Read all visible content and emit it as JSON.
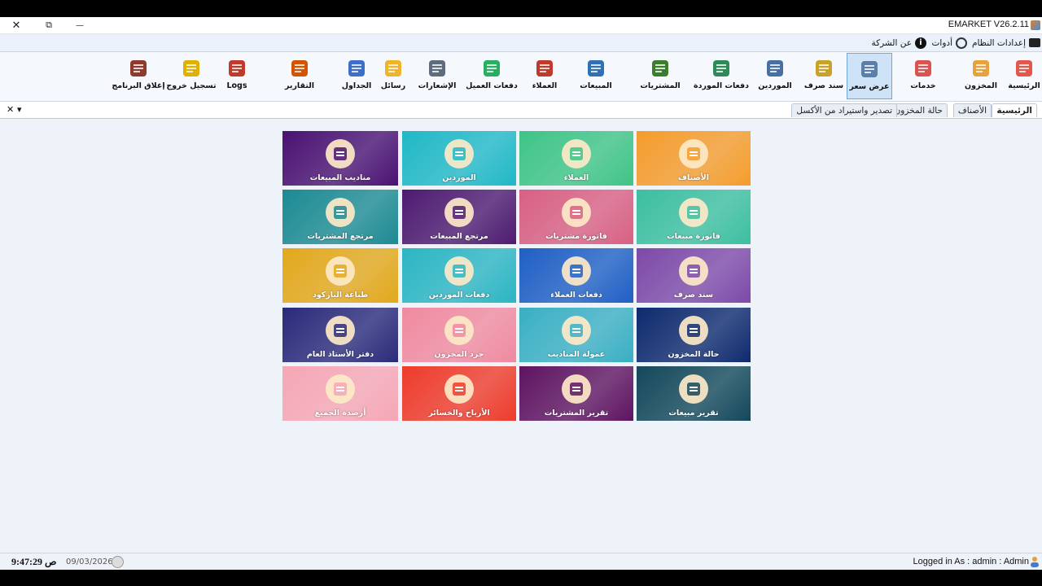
{
  "window": {
    "title": "EMARKET V26.2.11",
    "close_glyph": "✕",
    "restore_glyph": "⧉",
    "minimize_glyph": "—"
  },
  "menubar": {
    "settings": "إعدادات النظام",
    "tools": "أدوات",
    "about": "عن الشركة"
  },
  "ribbon": [
    {
      "label": "الرئيسية",
      "icon": "house-icon",
      "color": "#e2574c"
    },
    {
      "label": "المخزون",
      "icon": "warehouse-icon",
      "color": "#e8a23b"
    },
    {
      "label": "خدمات",
      "icon": "gift-icon",
      "color": "#d9534f"
    },
    {
      "label": "عرض سعر",
      "icon": "price-quote-icon",
      "color": "#5b7fa6"
    },
    {
      "label": "سند صرف",
      "icon": "cash-voucher-icon",
      "color": "#c9a227"
    },
    {
      "label": "الموردين",
      "icon": "supplier-icon",
      "color": "#4a6fa5"
    },
    {
      "label": "دفعات الموردة",
      "icon": "supplier-payment-icon",
      "color": "#2e8b57"
    },
    {
      "label": "المشتريات",
      "icon": "purchases-icon",
      "color": "#3a7d2c"
    },
    {
      "label": "المبيعات",
      "icon": "sales-cart-icon",
      "color": "#2f6fb3"
    },
    {
      "label": "العملاء",
      "icon": "customers-icon",
      "color": "#c0392b"
    },
    {
      "label": "دفعات العميل",
      "icon": "customer-payment-icon",
      "color": "#27ae60"
    },
    {
      "label": "الإشعارات",
      "icon": "notifications-icon",
      "color": "#5d6d7e"
    },
    {
      "label": "رسائل",
      "icon": "sms-envelope-icon",
      "color": "#f0b429"
    },
    {
      "label": "الجداول",
      "icon": "tables-grid-icon",
      "color": "#3d6ec9"
    },
    {
      "label": "التقارير",
      "icon": "reports-chart-icon",
      "color": "#d35400"
    },
    {
      "label": "Logs",
      "icon": "logs-file-icon",
      "color": "#c0392b"
    },
    {
      "label": "تسجيل خروج",
      "icon": "lock-icon",
      "color": "#e0b000"
    },
    {
      "label": "إغلاق البرنامج",
      "icon": "exit-door-icon",
      "color": "#8e3b2e"
    }
  ],
  "tabs": [
    {
      "label": "الرئيسية",
      "active": true
    },
    {
      "label": "الأصناف",
      "active": false
    },
    {
      "label": "حالة المخزون",
      "active": false
    },
    {
      "label": "تصدير واستيراد من الأكسل",
      "active": false
    }
  ],
  "tabctl": {
    "close": "✕",
    "menu": "▾"
  },
  "tiles": [
    {
      "label": "الأصناف",
      "icon": "box-icon",
      "bg": "#f49c2c"
    },
    {
      "label": "العملاء",
      "icon": "customer-card-icon",
      "bg": "#3ec486"
    },
    {
      "label": "الموردين",
      "icon": "worker-icon",
      "bg": "#20b8c6"
    },
    {
      "label": "مناديب المبيعات",
      "icon": "sales-rep-icon",
      "bg": "#4a1272"
    },
    {
      "label": "فاتورة مبيعات",
      "icon": "money-bill-icon",
      "bg": "#3cbfa0"
    },
    {
      "label": "فاتورة مشتريات",
      "icon": "invoice-icon",
      "bg": "#d86083"
    },
    {
      "label": "مرتجع المبيعات",
      "icon": "coins-icon",
      "bg": "#4d1a70"
    },
    {
      "label": "مرتجع المشتريات",
      "icon": "green-box-icon",
      "bg": "#1c8a92"
    },
    {
      "label": "سند صرف",
      "icon": "money-bag-icon",
      "bg": "#7d4aa8"
    },
    {
      "label": "دفعات العملاء",
      "icon": "customer-pay-icon",
      "bg": "#1f5fc4"
    },
    {
      "label": "دفعات الموردين",
      "icon": "supplier-pay-icon",
      "bg": "#2bb5c2"
    },
    {
      "label": "طباعة الباركود",
      "icon": "barcode-icon",
      "bg": "#e2a81c"
    },
    {
      "label": "حالة المخزون",
      "icon": "stock-status-icon",
      "bg": "#0e2a6e"
    },
    {
      "label": "عمولة المناديب",
      "icon": "commission-hand-icon",
      "bg": "#3aafc3"
    },
    {
      "label": "جرد المخزون",
      "icon": "inventory-arrows-icon",
      "bg": "#f08aa0"
    },
    {
      "label": "دفتر الأستاذ العام",
      "icon": "ledger-icon",
      "bg": "#2a2a7a"
    },
    {
      "label": "تقرير مبيعات",
      "icon": "sales-report-icon",
      "bg": "#13485a"
    },
    {
      "label": "تقرير المشتريات",
      "icon": "purchase-report-icon",
      "bg": "#5e1460"
    },
    {
      "label": "الأرباح والخسائر",
      "icon": "profit-loss-icon",
      "bg": "#ee3b2a"
    },
    {
      "label": "أرصدة الجميع",
      "icon": "balances-icon",
      "bg": "#f6a6b5"
    }
  ],
  "status": {
    "time": "9:47:29 ص",
    "date": "09/03/2026",
    "logged_in": "Logged in As :  admin  :  Admin"
  }
}
